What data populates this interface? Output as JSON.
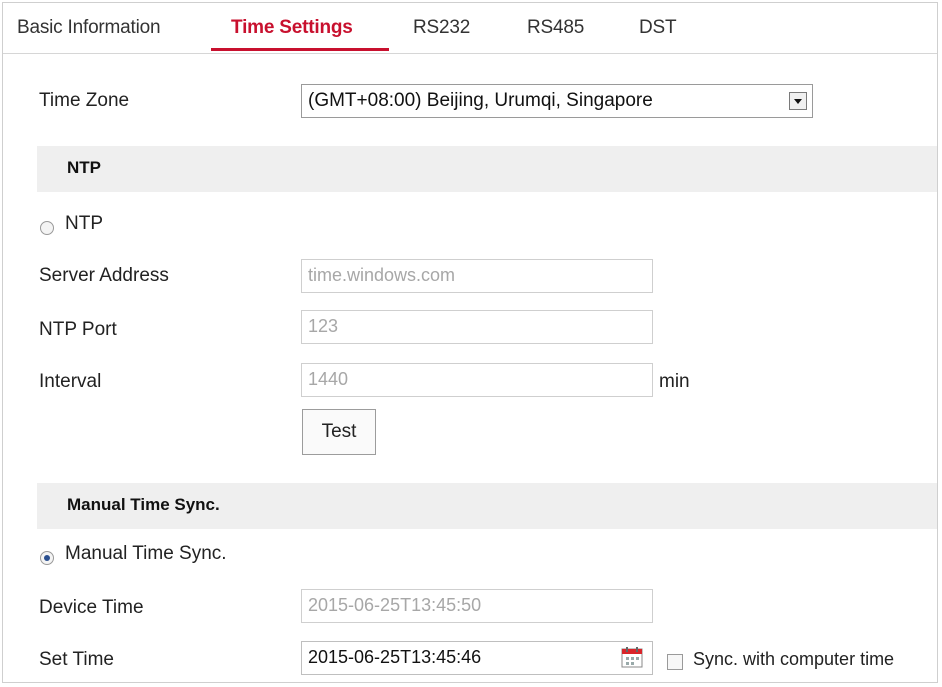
{
  "tabs": [
    {
      "label": "Basic Information",
      "active": false
    },
    {
      "label": "Time Settings",
      "active": true
    },
    {
      "label": "RS232",
      "active": false
    },
    {
      "label": "RS485",
      "active": false
    },
    {
      "label": "DST",
      "active": false
    }
  ],
  "time_zone": {
    "label": "Time Zone",
    "value": "(GMT+08:00) Beijing, Urumqi, Singapore"
  },
  "ntp": {
    "section_title": "NTP",
    "radio_label": "NTP",
    "selected": false,
    "server_address_label": "Server Address",
    "server_address_value": "time.windows.com",
    "port_label": "NTP Port",
    "port_value": "123",
    "interval_label": "Interval",
    "interval_value": "1440",
    "interval_unit": "min",
    "test_button": "Test"
  },
  "manual": {
    "section_title": "Manual Time Sync.",
    "radio_label": "Manual Time Sync.",
    "selected": true,
    "device_time_label": "Device Time",
    "device_time_value": "2015-06-25T13:45:50",
    "set_time_label": "Set Time",
    "set_time_value": "2015-06-25T13:45:46",
    "sync_label": "Sync. with computer time",
    "sync_checked": false
  },
  "icons": {
    "dropdown": "chevron-down-icon",
    "calendar": "calendar-icon"
  },
  "colors": {
    "accent": "#c8102e",
    "section_bg": "#efefef",
    "disabled_text": "#a7a7a7"
  }
}
